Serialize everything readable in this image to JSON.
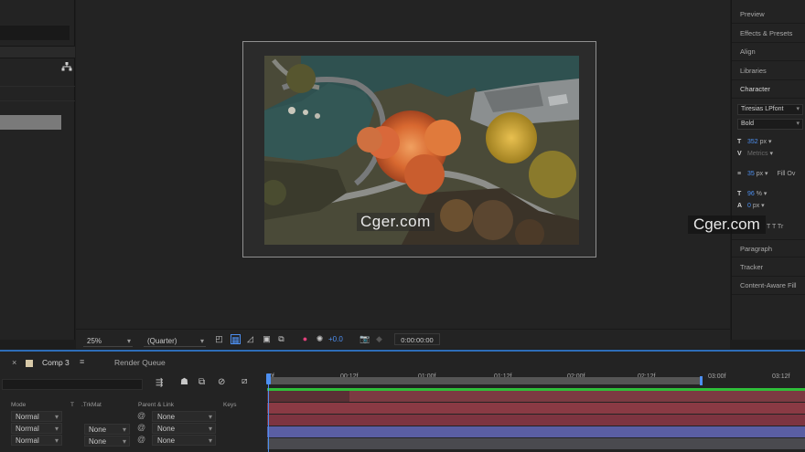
{
  "viewer": {
    "zoom": "25%",
    "resolution": "(Quarter)",
    "exposure": "+0.0",
    "timecode": "0:00:00:00"
  },
  "watermark": {
    "center": "Cger.com",
    "right": "Cger.com"
  },
  "right_panel": {
    "tabs": [
      "Preview",
      "Effects & Presets",
      "Align",
      "Libraries",
      "Character"
    ],
    "font_family": "Tiresias LPfont",
    "font_style": "Bold",
    "font_size": "352",
    "font_size_unit": "px",
    "kerning": "Metrics",
    "leading": "35",
    "leading_unit": "px",
    "fill_label": "Fill Ov",
    "vert_scale": "96",
    "vert_scale_unit": "%",
    "baseline": "0",
    "baseline_unit": "px",
    "styles_row": "T T Tr",
    "bottom_tabs": [
      "Paragraph",
      "Tracker",
      "Content-Aware Fill"
    ]
  },
  "timeline": {
    "comp_tab": "Comp 3",
    "render_tab": "Render Queue",
    "columns": {
      "mode": "Mode",
      "t": "T",
      "trkmat": ".TrkMat",
      "parent": "Parent & Link",
      "keys": "Keys"
    },
    "ruler_labels": [
      "0f",
      "00:12f",
      "01:00f",
      "01:12f",
      "02:00f",
      "02:12f",
      "03:00f",
      "03:12f"
    ],
    "rows": [
      {
        "mode": "Normal",
        "trkmat": "",
        "parent": "None"
      },
      {
        "mode": "Normal",
        "trkmat": "None",
        "parent": "None"
      },
      {
        "mode": "Normal",
        "trkmat": "None",
        "parent": "None"
      }
    ]
  },
  "colors": {
    "accent_blue": "#2d6db8",
    "value_blue": "#4d8ff0",
    "track_green": "#2fbf3a",
    "track_red": "#8a3a44",
    "track_purple": "#5a5ea3"
  }
}
